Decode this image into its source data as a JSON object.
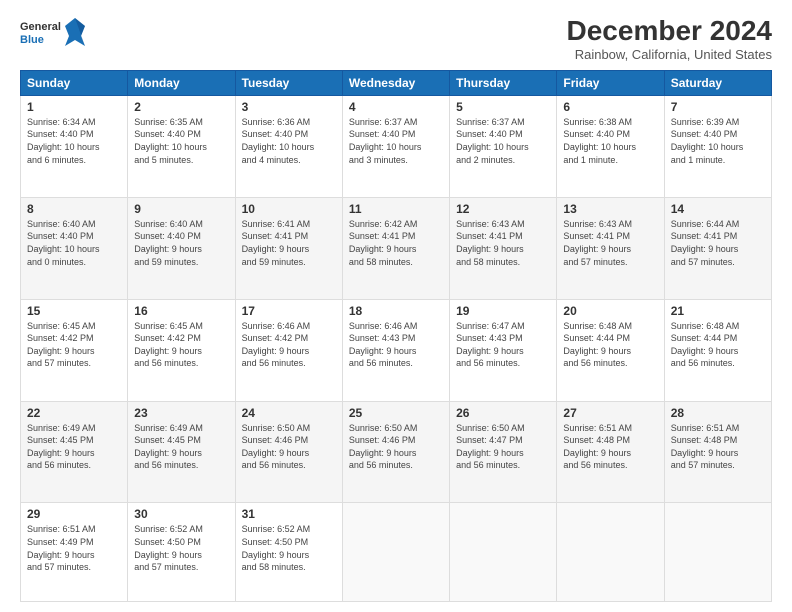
{
  "header": {
    "logo_line1": "General",
    "logo_line2": "Blue",
    "title": "December 2024",
    "subtitle": "Rainbow, California, United States"
  },
  "days_of_week": [
    "Sunday",
    "Monday",
    "Tuesday",
    "Wednesday",
    "Thursday",
    "Friday",
    "Saturday"
  ],
  "weeks": [
    [
      {
        "day": "1",
        "info": "Sunrise: 6:34 AM\nSunset: 4:40 PM\nDaylight: 10 hours\nand 6 minutes."
      },
      {
        "day": "2",
        "info": "Sunrise: 6:35 AM\nSunset: 4:40 PM\nDaylight: 10 hours\nand 5 minutes."
      },
      {
        "day": "3",
        "info": "Sunrise: 6:36 AM\nSunset: 4:40 PM\nDaylight: 10 hours\nand 4 minutes."
      },
      {
        "day": "4",
        "info": "Sunrise: 6:37 AM\nSunset: 4:40 PM\nDaylight: 10 hours\nand 3 minutes."
      },
      {
        "day": "5",
        "info": "Sunrise: 6:37 AM\nSunset: 4:40 PM\nDaylight: 10 hours\nand 2 minutes."
      },
      {
        "day": "6",
        "info": "Sunrise: 6:38 AM\nSunset: 4:40 PM\nDaylight: 10 hours\nand 1 minute."
      },
      {
        "day": "7",
        "info": "Sunrise: 6:39 AM\nSunset: 4:40 PM\nDaylight: 10 hours\nand 1 minute."
      }
    ],
    [
      {
        "day": "8",
        "info": "Sunrise: 6:40 AM\nSunset: 4:40 PM\nDaylight: 10 hours\nand 0 minutes."
      },
      {
        "day": "9",
        "info": "Sunrise: 6:40 AM\nSunset: 4:40 PM\nDaylight: 9 hours\nand 59 minutes."
      },
      {
        "day": "10",
        "info": "Sunrise: 6:41 AM\nSunset: 4:41 PM\nDaylight: 9 hours\nand 59 minutes."
      },
      {
        "day": "11",
        "info": "Sunrise: 6:42 AM\nSunset: 4:41 PM\nDaylight: 9 hours\nand 58 minutes."
      },
      {
        "day": "12",
        "info": "Sunrise: 6:43 AM\nSunset: 4:41 PM\nDaylight: 9 hours\nand 58 minutes."
      },
      {
        "day": "13",
        "info": "Sunrise: 6:43 AM\nSunset: 4:41 PM\nDaylight: 9 hours\nand 57 minutes."
      },
      {
        "day": "14",
        "info": "Sunrise: 6:44 AM\nSunset: 4:41 PM\nDaylight: 9 hours\nand 57 minutes."
      }
    ],
    [
      {
        "day": "15",
        "info": "Sunrise: 6:45 AM\nSunset: 4:42 PM\nDaylight: 9 hours\nand 57 minutes."
      },
      {
        "day": "16",
        "info": "Sunrise: 6:45 AM\nSunset: 4:42 PM\nDaylight: 9 hours\nand 56 minutes."
      },
      {
        "day": "17",
        "info": "Sunrise: 6:46 AM\nSunset: 4:42 PM\nDaylight: 9 hours\nand 56 minutes."
      },
      {
        "day": "18",
        "info": "Sunrise: 6:46 AM\nSunset: 4:43 PM\nDaylight: 9 hours\nand 56 minutes."
      },
      {
        "day": "19",
        "info": "Sunrise: 6:47 AM\nSunset: 4:43 PM\nDaylight: 9 hours\nand 56 minutes."
      },
      {
        "day": "20",
        "info": "Sunrise: 6:48 AM\nSunset: 4:44 PM\nDaylight: 9 hours\nand 56 minutes."
      },
      {
        "day": "21",
        "info": "Sunrise: 6:48 AM\nSunset: 4:44 PM\nDaylight: 9 hours\nand 56 minutes."
      }
    ],
    [
      {
        "day": "22",
        "info": "Sunrise: 6:49 AM\nSunset: 4:45 PM\nDaylight: 9 hours\nand 56 minutes."
      },
      {
        "day": "23",
        "info": "Sunrise: 6:49 AM\nSunset: 4:45 PM\nDaylight: 9 hours\nand 56 minutes."
      },
      {
        "day": "24",
        "info": "Sunrise: 6:50 AM\nSunset: 4:46 PM\nDaylight: 9 hours\nand 56 minutes."
      },
      {
        "day": "25",
        "info": "Sunrise: 6:50 AM\nSunset: 4:46 PM\nDaylight: 9 hours\nand 56 minutes."
      },
      {
        "day": "26",
        "info": "Sunrise: 6:50 AM\nSunset: 4:47 PM\nDaylight: 9 hours\nand 56 minutes."
      },
      {
        "day": "27",
        "info": "Sunrise: 6:51 AM\nSunset: 4:48 PM\nDaylight: 9 hours\nand 56 minutes."
      },
      {
        "day": "28",
        "info": "Sunrise: 6:51 AM\nSunset: 4:48 PM\nDaylight: 9 hours\nand 57 minutes."
      }
    ],
    [
      {
        "day": "29",
        "info": "Sunrise: 6:51 AM\nSunset: 4:49 PM\nDaylight: 9 hours\nand 57 minutes."
      },
      {
        "day": "30",
        "info": "Sunrise: 6:52 AM\nSunset: 4:50 PM\nDaylight: 9 hours\nand 57 minutes."
      },
      {
        "day": "31",
        "info": "Sunrise: 6:52 AM\nSunset: 4:50 PM\nDaylight: 9 hours\nand 58 minutes."
      },
      {
        "day": "",
        "info": ""
      },
      {
        "day": "",
        "info": ""
      },
      {
        "day": "",
        "info": ""
      },
      {
        "day": "",
        "info": ""
      }
    ]
  ]
}
